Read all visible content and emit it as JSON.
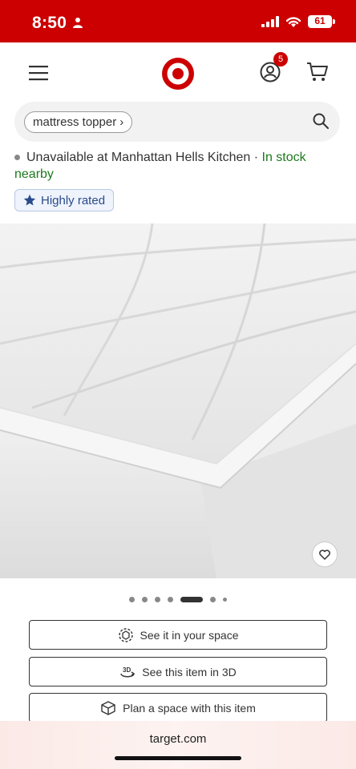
{
  "status_bar": {
    "time": "8:50",
    "battery": "61"
  },
  "header": {
    "account_badge_count": "5",
    "brand_color": "#cc0000"
  },
  "search": {
    "query_chip": "mattress topper",
    "chip_arrow": "›"
  },
  "availability": {
    "store_text": "Unavailable at Manhattan Hells Kitchen",
    "separator": " · ",
    "stock_text": "In stock",
    "nearby_text": "nearby"
  },
  "badges": {
    "highly_rated": "Highly rated"
  },
  "carousel": {
    "total_dots": 7,
    "active_index": 4
  },
  "actions": {
    "see_in_space": "See it in your space",
    "see_in_3d": "See this item in 3D",
    "plan_space": "Plan a space with this item"
  },
  "browser": {
    "url": "target.com"
  }
}
